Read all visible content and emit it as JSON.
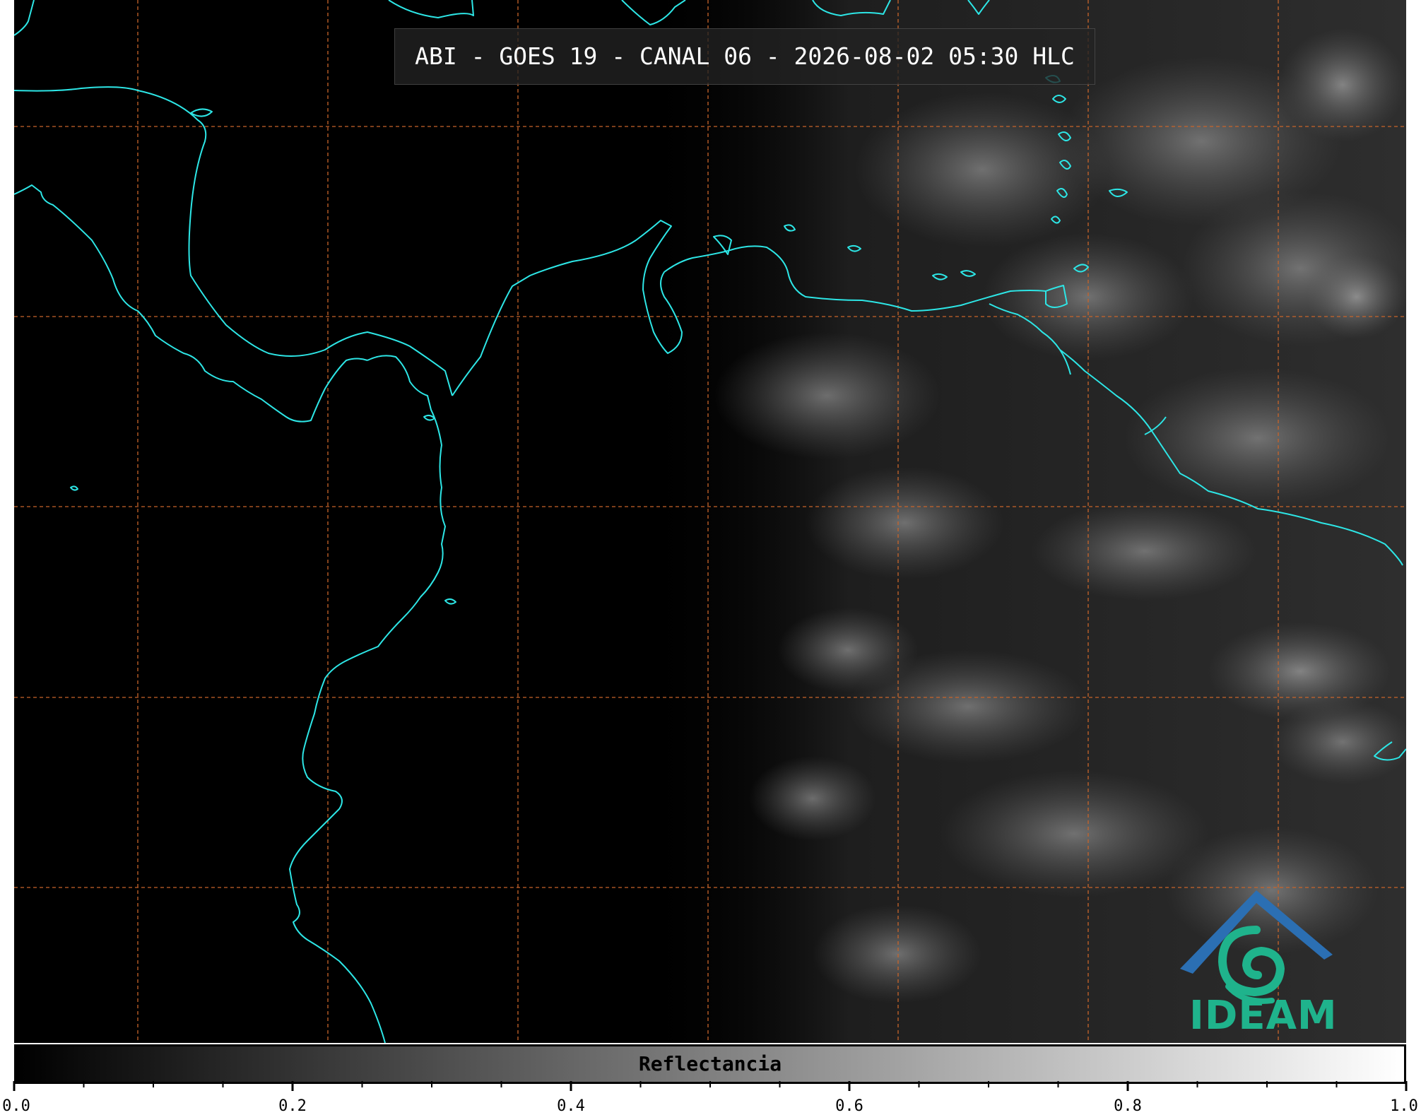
{
  "title": "ABI - GOES 19 - CANAL 06 - 2026-08-02 05:30 HLC",
  "logo": {
    "text": "IDEAM",
    "text_color": "#1fb38c",
    "roof_color": "#2b6fb3"
  },
  "colorbar": {
    "label": "Reflectancia",
    "min": 0.0,
    "max": 1.0,
    "tick_labels": [
      "0.0",
      "0.2",
      "0.4",
      "0.6",
      "0.8",
      "1.0"
    ],
    "minor_tick_count": 20
  },
  "colors": {
    "coastline": "#2de6e6",
    "graticule": "#c8642a",
    "background": "#000000"
  }
}
